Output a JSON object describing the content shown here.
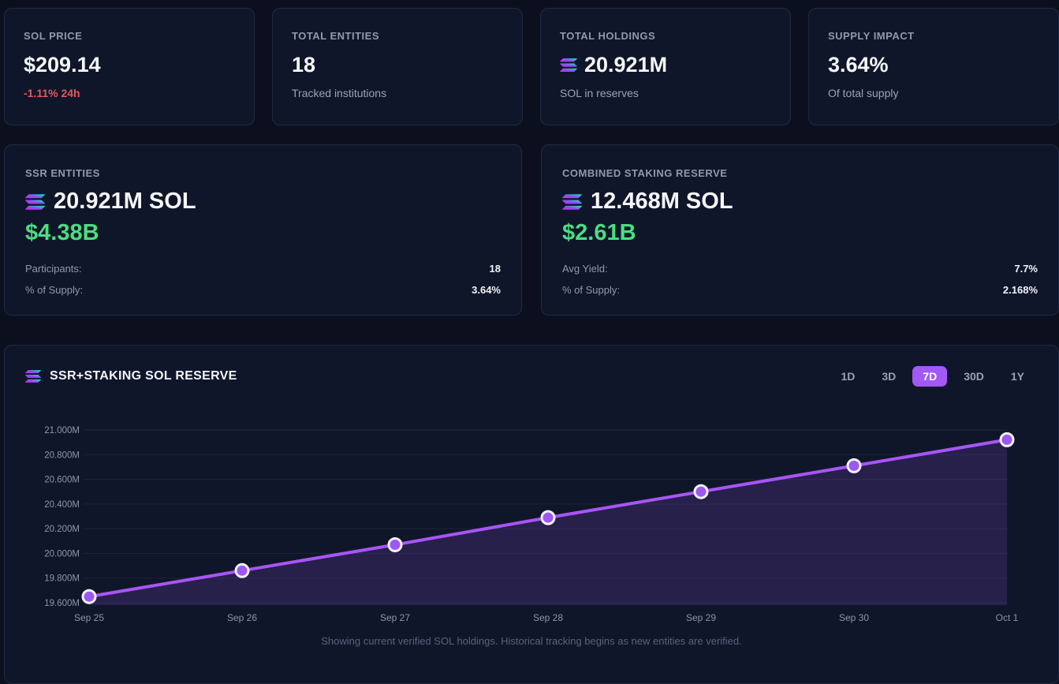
{
  "colors": {
    "accent_purple": "#a855f7",
    "active_range_bg": "#a259f7",
    "positive_green": "#4ade80",
    "negative_red": "#e0595f",
    "solana_gradient": [
      "#DC1FFF",
      "#8752F3",
      "#00FFA3"
    ]
  },
  "stats": [
    {
      "label": "SOL PRICE",
      "value": "$209.14",
      "sub": "-1.11% 24h",
      "sub_type": "negative"
    },
    {
      "label": "TOTAL ENTITIES",
      "value": "18",
      "sub": "Tracked institutions",
      "sub_type": "muted"
    },
    {
      "label": "TOTAL HOLDINGS",
      "value": "20.921M",
      "icon": "solana-logo-icon",
      "sub": "SOL in reserves",
      "sub_type": "muted"
    },
    {
      "label": "SUPPLY IMPACT",
      "value": "3.64%",
      "sub": "Of total supply",
      "sub_type": "muted"
    }
  ],
  "reserve_cards": [
    {
      "label": "SSR ENTITIES",
      "icon": "solana-logo-icon",
      "amount": "20.921M SOL",
      "usd": "$4.38B",
      "rows": [
        {
          "key": "Participants:",
          "value": "18"
        },
        {
          "key": "% of Supply:",
          "value": "3.64%"
        }
      ]
    },
    {
      "label": "COMBINED STAKING RESERVE",
      "icon": "solana-logo-icon",
      "amount": "12.468M SOL",
      "usd": "$2.61B",
      "rows": [
        {
          "key": "Avg Yield:",
          "value": "7.7%"
        },
        {
          "key": "% of Supply:",
          "value": "2.168%"
        }
      ]
    }
  ],
  "chart_card": {
    "title": "SSR+STAKING SOL RESERVE",
    "icon": "solana-logo-icon",
    "ranges": [
      {
        "label": "1D",
        "active": false
      },
      {
        "label": "3D",
        "active": false
      },
      {
        "label": "7D",
        "active": true
      },
      {
        "label": "30D",
        "active": false
      },
      {
        "label": "1Y",
        "active": false
      }
    ],
    "footnote": "Showing current verified SOL holdings. Historical tracking begins as new entities are verified."
  },
  "chart_data": {
    "type": "line",
    "title": "SSR+STAKING SOL RESERVE",
    "x": [
      "Sep 25",
      "Sep 26",
      "Sep 27",
      "Sep 28",
      "Sep 29",
      "Sep 30",
      "Oct 1"
    ],
    "series": [
      {
        "name": "SSR+Staking SOL Reserve (M SOL)",
        "values": [
          19.65,
          19.86,
          20.07,
          20.29,
          20.5,
          20.71,
          20.921
        ]
      }
    ],
    "ylim": [
      19.6,
      21.0
    ],
    "yticks": [
      19.6,
      19.8,
      20.0,
      20.2,
      20.4,
      20.6,
      20.8,
      21.0
    ],
    "ytick_labels": [
      "19.600M",
      "19.800M",
      "20.000M",
      "20.200M",
      "20.400M",
      "20.600M",
      "20.800M",
      "21.000M"
    ],
    "grid": true,
    "legend": false,
    "area": true,
    "line_color": "#a855f7",
    "point_fill": "#9d57f2",
    "point_ring": "#f4f1fb",
    "area_fill": "rgba(154,85,247,0.16)"
  }
}
